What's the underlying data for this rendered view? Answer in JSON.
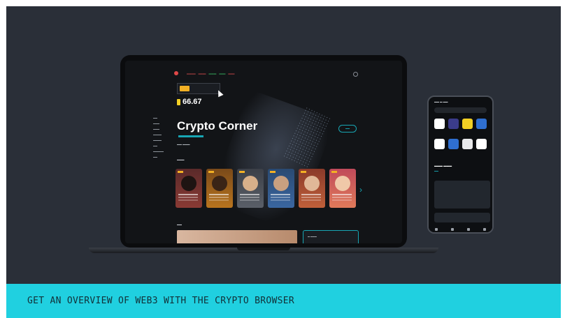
{
  "banner": {
    "text": "GET AN OVERVIEW OF WEB3 WITH THE CRYPTO BROWSER"
  },
  "browser": {
    "price": "66.67",
    "hero_title": "Crypto Corner",
    "colors": {
      "accent": "#18a6b4",
      "highlight": "#f2b024",
      "banner": "#20d0e0"
    }
  }
}
